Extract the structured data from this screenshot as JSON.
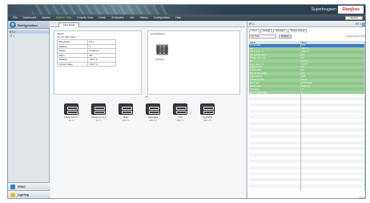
{
  "window": {
    "product": "Superbrugsen",
    "brand": "Danfoss",
    "account_button": "Account"
  },
  "menu": [
    {
      "label": "File",
      "active": false
    },
    {
      "label": "Dashboard",
      "active": false
    },
    {
      "label": "Alarms",
      "active": false
    },
    {
      "label": "System View",
      "active": true
    },
    {
      "label": "Graphic View",
      "active": false
    },
    {
      "label": "Detail",
      "active": false
    },
    {
      "label": "Schedules",
      "active": false
    },
    {
      "label": "Info",
      "active": false
    },
    {
      "label": "History",
      "active": false
    },
    {
      "label": "Configuration",
      "active": false
    },
    {
      "label": "Help",
      "active": false
    }
  ],
  "sidebar": {
    "title": "Refrigeration",
    "items": [
      "RT 1",
      "LT 1"
    ],
    "selected_index": 0,
    "bottom": [
      {
        "label": "HVAC",
        "icon": "hvac-icon"
      },
      {
        "label": "Lighting",
        "icon": "lighting-icon"
      }
    ]
  },
  "main": {
    "tab": "Case Detail",
    "valves": {
      "title": "Valves",
      "device": "AK-CC 550 Case",
      "rows": [
        {
          "label": "Description",
          "value": "RT 1"
        },
        {
          "label": "Address",
          "value": "1"
        },
        {
          "label": "Status",
          "value": "Power up"
        },
        {
          "label": "Alarm",
          "value": "OK"
        },
        {
          "label": "Setpoint",
          "value": "-35.0 °C"
        },
        {
          "label": "Current Value",
          "value": "-35.0 °C"
        }
      ]
    },
    "compressors": {
      "title": "Compressors",
      "item": "Pumpset"
    },
    "cases": [
      {
        "name": "Chees Fox 3.1",
        "temp": "3.6 °C"
      },
      {
        "name": "Cheese Fox 3.1",
        "temp": "3.6 °C"
      },
      {
        "name": "Meat",
        "temp": "-990.0 °C"
      },
      {
        "name": "Sausages",
        "temp": "-990.0 °C"
      },
      {
        "name": "Cold",
        "temp": "-990.0 °C"
      },
      {
        "name": "Vegetable",
        "temp": "-990.0 °C"
      }
    ]
  },
  "right_panel": {
    "title": "RT 1",
    "title_right": "RT 1",
    "tabs": [
      "Status",
      "Settings",
      "Schedules",
      "Service settings"
    ],
    "active_tab": 0,
    "filter_value": "Key Data",
    "filter_button": "Refresh",
    "updated": "Updated: 08:12:23 PM",
    "columns": [
      "Name",
      "Value"
    ],
    "rows": [
      {
        "name": "Temperature",
        "value": "OFF",
        "style": "highlight"
      },
      {
        "name": "S3",
        "value": "-35.0 °C",
        "style": "green"
      },
      {
        "name": "Cons. temp. ref",
        "value": "-35.0 °C",
        "style": "green"
      },
      {
        "name": "Thermostat cut-in",
        "value": "0.0",
        "style": "green"
      },
      {
        "name": "Display temp. S4",
        "value": "0.0",
        "style": "green"
      },
      {
        "name": "S4",
        "value": "0.0 °C",
        "style": "green"
      },
      {
        "name": "Evap. temp. ref",
        "value": "-0.0 °C",
        "style": "green"
      },
      {
        "name": "Cond. ref. S5",
        "value": "0.0",
        "style": "green"
      },
      {
        "name": "Defrost state",
        "value": "0.0",
        "style": "green"
      },
      {
        "name": "Defrost step length",
        "value": "0.0",
        "style": "green"
      },
      {
        "name": "Night setback",
        "value": "OFF",
        "style": "green"
      },
      {
        "name": "% AKV ATPWM",
        "value": "0.0 %",
        "style": "green"
      },
      {
        "name": "Rated gas",
        "value": "R 744 ATIM",
        "style": "green"
      },
      {
        "name": "Defrost state",
        "value": "Power up",
        "style": "green"
      },
      {
        "name": "Superheat",
        "value": "0.0",
        "style": "green"
      },
      {
        "name": "No. of compressors",
        "value": "0",
        "style": "green"
      },
      {
        "name": "",
        "value": "",
        "style": "empty"
      },
      {
        "name": "",
        "value": "",
        "style": "empty"
      },
      {
        "name": "",
        "value": "",
        "style": "empty"
      },
      {
        "name": "",
        "value": "",
        "style": "empty"
      },
      {
        "name": "",
        "value": "",
        "style": "empty"
      },
      {
        "name": "",
        "value": "",
        "style": "empty"
      },
      {
        "name": "",
        "value": "",
        "style": "empty"
      },
      {
        "name": "",
        "value": "",
        "style": "empty"
      },
      {
        "name": "",
        "value": "",
        "style": "empty"
      },
      {
        "name": "",
        "value": "",
        "style": "empty"
      },
      {
        "name": "",
        "value": "",
        "style": "empty"
      },
      {
        "name": "",
        "value": "",
        "style": "empty"
      },
      {
        "name": "",
        "value": "",
        "style": "empty"
      },
      {
        "name": "",
        "value": "",
        "style": "empty"
      },
      {
        "name": "",
        "value": "",
        "style": "empty"
      },
      {
        "name": "",
        "value": "",
        "style": "empty"
      },
      {
        "name": "",
        "value": "",
        "style": "empty"
      },
      {
        "name": "",
        "value": "",
        "style": "empty"
      },
      {
        "name": "",
        "value": "",
        "style": "empty"
      },
      {
        "name": "",
        "value": "",
        "style": "empty"
      },
      {
        "name": "",
        "value": "",
        "style": "empty"
      },
      {
        "name": "",
        "value": "",
        "style": "empty"
      },
      {
        "name": "",
        "value": "",
        "style": "empty"
      },
      {
        "name": "",
        "value": "",
        "style": "empty"
      },
      {
        "name": "",
        "value": "",
        "style": "empty"
      },
      {
        "name": "",
        "value": "",
        "style": "empty"
      },
      {
        "name": "",
        "value": "",
        "style": "empty"
      },
      {
        "name": "",
        "value": "",
        "style": "empty"
      },
      {
        "name": "",
        "value": "",
        "style": "empty"
      },
      {
        "name": "",
        "value": "",
        "style": "empty"
      },
      {
        "name": "",
        "value": "",
        "style": "empty"
      }
    ],
    "status": "OK (0)"
  },
  "colors": {
    "accent": "#3d7fc1",
    "status_green": "#8fc78b",
    "highlight_row": "#3a78c9",
    "active_menu": "#9ed36a",
    "brand_red": "#d11a2a"
  }
}
